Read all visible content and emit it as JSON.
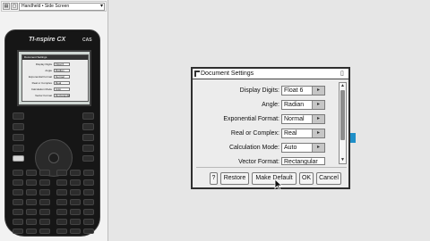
{
  "toolbar": {
    "view_select": "Handheld • Side Screen"
  },
  "handheld": {
    "brand": "TI-nspire CX",
    "model": "CAS",
    "mini_dialog_title": "Document Settings",
    "mini_settings": [
      {
        "label": "Display Digits",
        "value": "Float 6"
      },
      {
        "label": "Angle",
        "value": "Radian"
      },
      {
        "label": "Exponential Format",
        "value": "Normal"
      },
      {
        "label": "Real or Complex",
        "value": "Real"
      },
      {
        "label": "Calculation Mode",
        "value": "Auto"
      },
      {
        "label": "Vector Format",
        "value": "Rectangular"
      }
    ]
  },
  "dialog": {
    "title": "Document Settings",
    "settings": [
      {
        "label": "Display Digits:",
        "value": "Float 6"
      },
      {
        "label": "Angle:",
        "value": "Radian"
      },
      {
        "label": "Exponential Format:",
        "value": "Normal"
      },
      {
        "label": "Real or Complex:",
        "value": "Real"
      },
      {
        "label": "Calculation Mode:",
        "value": "Auto"
      },
      {
        "label": "Vector Format:",
        "value": "Rectangular"
      }
    ],
    "buttons": {
      "help": "?",
      "restore": "Restore",
      "make_default": "Make Default",
      "ok": "OK",
      "cancel": "Cancel"
    }
  },
  "colors": {
    "accent_tab": "#1f8fc8",
    "handheld_body": "#161616",
    "dialog_bg": "#ececec"
  },
  "icons": [
    "document-icon",
    "close-icon",
    "dropdown-arrow-icon",
    "scroll-up-icon",
    "scroll-down-icon",
    "mouse-cursor-icon"
  ]
}
